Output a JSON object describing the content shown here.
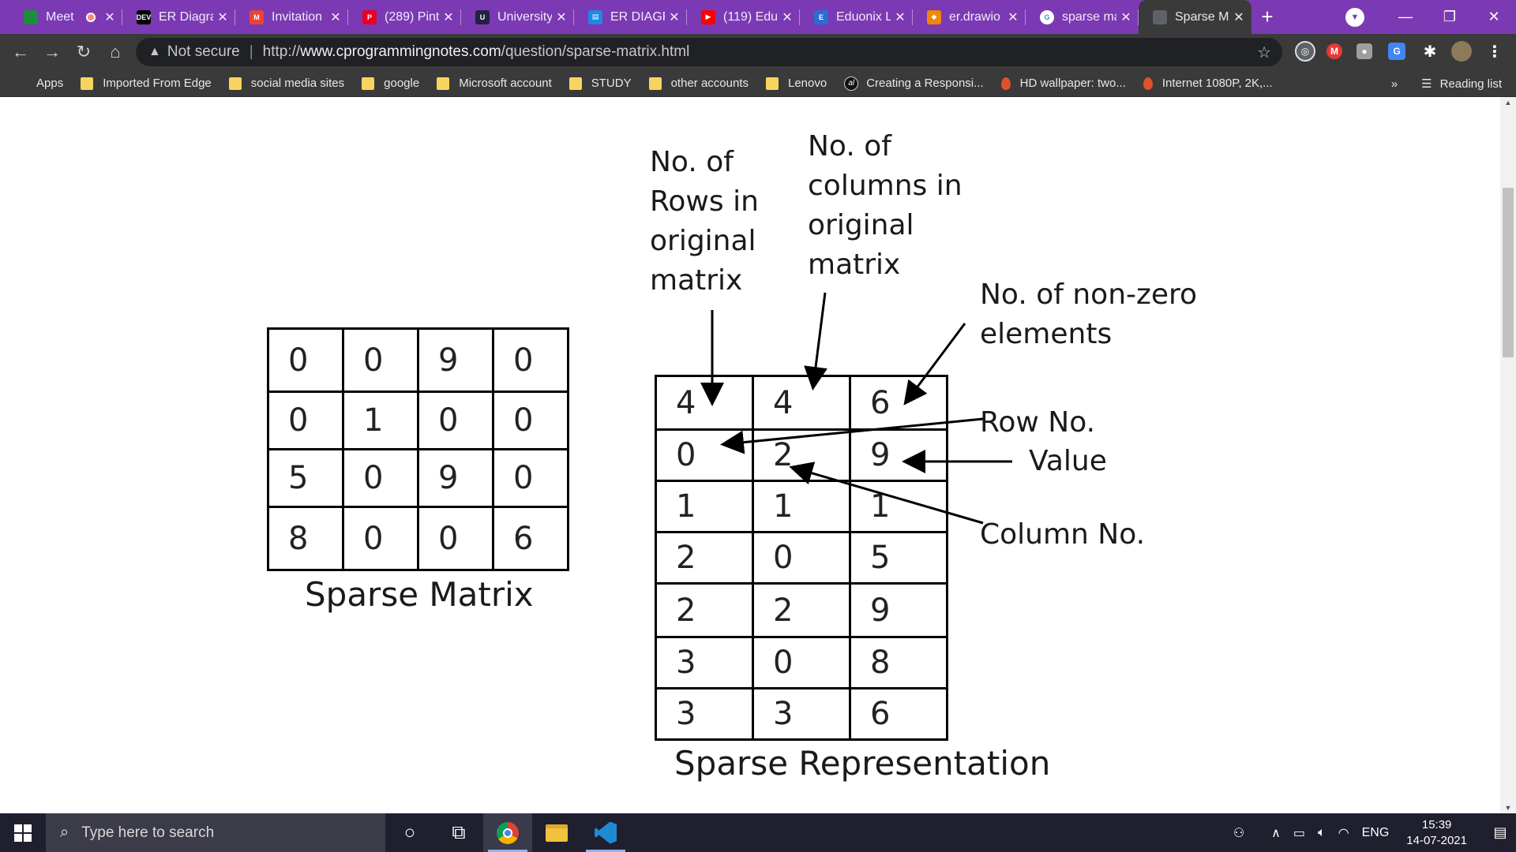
{
  "tabs": [
    {
      "title": "Meet",
      "favicon_color": "#1e8e3e",
      "favicon_glyph": "",
      "recording": true
    },
    {
      "title": "ER Diagra",
      "favicon_color": "#000000",
      "favicon_glyph": "DEV"
    },
    {
      "title": "Invitation",
      "favicon_color": "#ea4335",
      "favicon_glyph": "M"
    },
    {
      "title": "(289) Pint",
      "favicon_color": "#e60023",
      "favicon_glyph": "P"
    },
    {
      "title": "University",
      "favicon_color": "#222244",
      "favicon_glyph": "U"
    },
    {
      "title": "ER DIAGR",
      "favicon_color": "#1e88e5",
      "favicon_glyph": "▤"
    },
    {
      "title": "(119) Edu",
      "favicon_color": "#ff0000",
      "favicon_glyph": "▶"
    },
    {
      "title": "Eduonix L",
      "favicon_color": "#2b6cd4",
      "favicon_glyph": "E"
    },
    {
      "title": "er.drawio",
      "favicon_color": "#f08705",
      "favicon_glyph": "◆"
    },
    {
      "title": "sparse ma",
      "favicon_color": "#ffffff",
      "favicon_glyph": "G"
    },
    {
      "title": "Sparse M",
      "favicon_color": "#5f6368",
      "favicon_glyph": "",
      "active": true
    }
  ],
  "toolbar": {
    "security": "Not secure",
    "url_scheme": "http://",
    "url_host": "www.cprogrammingnotes.com",
    "url_path": "/question/sparse-matrix.html"
  },
  "bookmarks": [
    {
      "label": "Apps",
      "icon": "apps-icon"
    },
    {
      "label": "Imported From Edge",
      "icon": "folder-icon"
    },
    {
      "label": "social media sites",
      "icon": "folder-icon"
    },
    {
      "label": "google",
      "icon": "folder-icon"
    },
    {
      "label": "Microsoft account",
      "icon": "folder-icon"
    },
    {
      "label": "STUDY",
      "icon": "folder-icon"
    },
    {
      "label": "other accounts",
      "icon": "folder-icon"
    },
    {
      "label": "Lenovo",
      "icon": "folder-icon"
    },
    {
      "label": "Creating a Responsi...",
      "icon": "al-icon"
    },
    {
      "label": "HD wallpaper: two...",
      "icon": "flame-icon"
    },
    {
      "label": "Internet 1080P, 2K,...",
      "icon": "flame-icon"
    }
  ],
  "bookmarks_more": "»",
  "reading_list": "Reading list",
  "content": {
    "sparse_matrix": [
      [
        "0",
        "0",
        "9",
        "0"
      ],
      [
        "0",
        "1",
        "0",
        "0"
      ],
      [
        "5",
        "0",
        "9",
        "0"
      ],
      [
        "8",
        "0",
        "0",
        "6"
      ]
    ],
    "sparse_matrix_caption": "Sparse Matrix",
    "sparse_representation": [
      [
        "4",
        "4",
        "6"
      ],
      [
        "0",
        "2",
        "9"
      ],
      [
        "1",
        "1",
        "1"
      ],
      [
        "2",
        "0",
        "5"
      ],
      [
        "2",
        "2",
        "9"
      ],
      [
        "3",
        "0",
        "8"
      ],
      [
        "3",
        "3",
        "6"
      ]
    ],
    "sparse_representation_caption": "Sparse Representation",
    "label_rows": "No. of\nRows in\noriginal\nmatrix",
    "label_cols": "No. of\ncolumns in\noriginal\nmatrix",
    "label_nonzero": "No. of non-zero\nelements",
    "label_row_no": "Row No.",
    "label_value": "Value",
    "label_col_no": "Column No."
  },
  "taskbar": {
    "search_placeholder": "Type here to search",
    "language": "ENG",
    "time": "15:39",
    "date": "14-07-2021"
  }
}
